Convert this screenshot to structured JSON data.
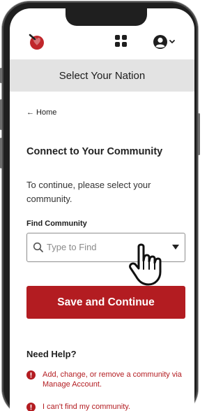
{
  "header": {
    "logo_icon": "heart-logo-icon",
    "apps_icon": "grid-apps-icon",
    "account_icon": "user-circle-icon"
  },
  "page": {
    "title": "Select Your Nation",
    "back_label": "← Home",
    "heading": "Connect to Your Community",
    "description": "To continue, please select your community."
  },
  "form": {
    "field_label": "Find Community",
    "placeholder": "Type to Find",
    "submit_label": "Save and Continue"
  },
  "help": {
    "title": "Need Help?",
    "items": [
      {
        "label": "Add, change, or remove a community via Manage Account."
      },
      {
        "label": "I can't find my community."
      }
    ]
  },
  "colors": {
    "accent": "#b31c21",
    "title_bar": "#e3e3e3"
  }
}
